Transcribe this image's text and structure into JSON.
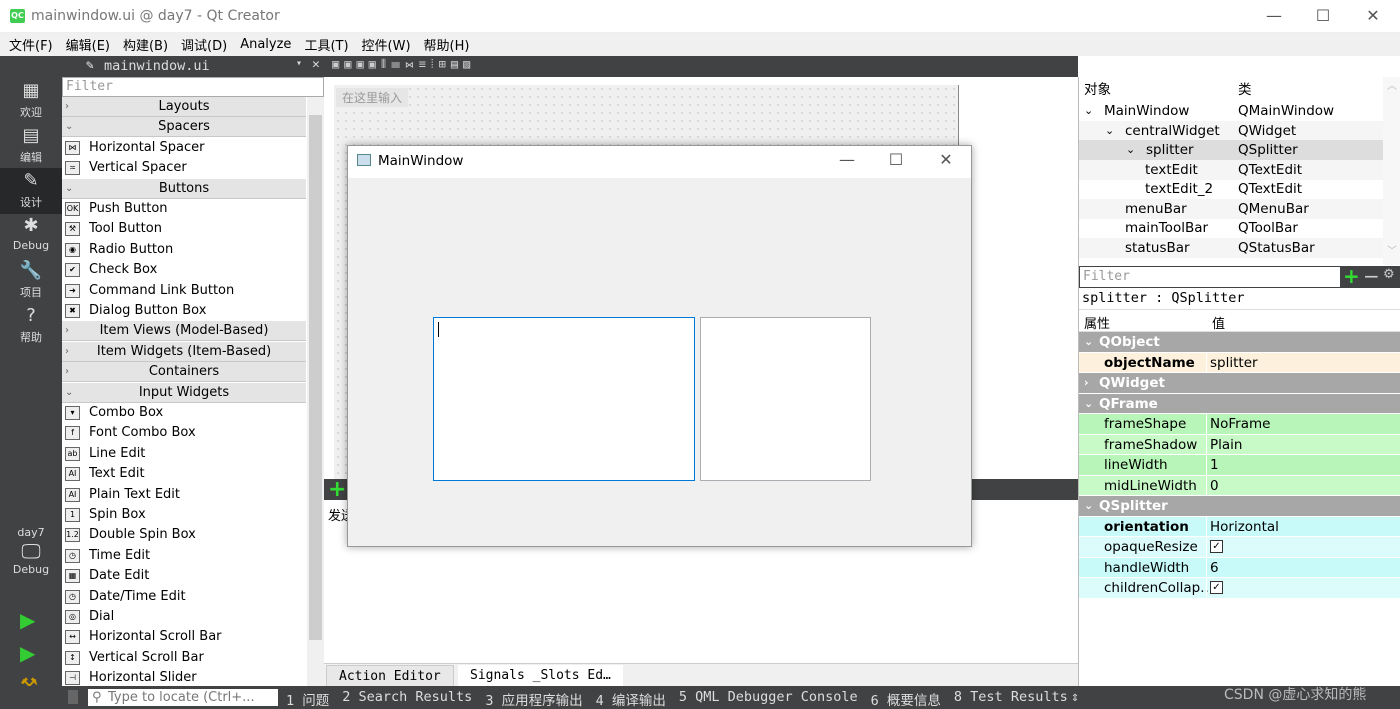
{
  "window": {
    "title": "mainwindow.ui @ day7 - Qt Creator",
    "logo": "QC",
    "minimize": "—",
    "maximize": "☐",
    "close": "✕"
  },
  "menu": [
    "文件(F)",
    "编辑(E)",
    "构建(B)",
    "调试(D)",
    "Analyze",
    "工具(T)",
    "控件(W)",
    "帮助(H)"
  ],
  "modes": [
    {
      "label": "欢迎",
      "icon": "grid-icon"
    },
    {
      "label": "编辑",
      "icon": "edit-icon"
    },
    {
      "label": "设计",
      "icon": "pencil-icon"
    },
    {
      "label": "Debug",
      "icon": "bug-icon"
    },
    {
      "label": "项目",
      "icon": "wrench-icon"
    },
    {
      "label": "帮助",
      "icon": "help-icon"
    }
  ],
  "kit": {
    "project": "day7",
    "mode": "Debug"
  },
  "editor": {
    "filename": "mainwindow.ui"
  },
  "widgetbox": {
    "filter_placeholder": "Filter",
    "rows": [
      {
        "t": "cat",
        "label": "Layouts",
        "open": false
      },
      {
        "t": "cat",
        "label": "Spacers",
        "open": true
      },
      {
        "t": "item",
        "label": "Horizontal Spacer",
        "icon": "⋈"
      },
      {
        "t": "item",
        "label": "Vertical Spacer",
        "icon": "≍"
      },
      {
        "t": "cat",
        "label": "Buttons",
        "open": true
      },
      {
        "t": "item",
        "label": "Push Button",
        "icon": "OK"
      },
      {
        "t": "item",
        "label": "Tool Button",
        "icon": "⚒"
      },
      {
        "t": "item",
        "label": "Radio Button",
        "icon": "◉"
      },
      {
        "t": "item",
        "label": "Check Box",
        "icon": "✔"
      },
      {
        "t": "item",
        "label": "Command Link Button",
        "icon": "➜"
      },
      {
        "t": "item",
        "label": "Dialog Button Box",
        "icon": "✖"
      },
      {
        "t": "cat",
        "label": "Item Views (Model-Based)",
        "open": false
      },
      {
        "t": "cat",
        "label": "Item Widgets (Item-Based)",
        "open": false
      },
      {
        "t": "cat",
        "label": "Containers",
        "open": false
      },
      {
        "t": "cat",
        "label": "Input Widgets",
        "open": true
      },
      {
        "t": "item",
        "label": "Combo Box",
        "icon": "▾"
      },
      {
        "t": "item",
        "label": "Font Combo Box",
        "icon": "f"
      },
      {
        "t": "item",
        "label": "Line Edit",
        "icon": "ab"
      },
      {
        "t": "item",
        "label": "Text Edit",
        "icon": "AI"
      },
      {
        "t": "item",
        "label": "Plain Text Edit",
        "icon": "AI"
      },
      {
        "t": "item",
        "label": "Spin Box",
        "icon": "1"
      },
      {
        "t": "item",
        "label": "Double Spin Box",
        "icon": "1.2"
      },
      {
        "t": "item",
        "label": "Time Edit",
        "icon": "◷"
      },
      {
        "t": "item",
        "label": "Date Edit",
        "icon": "▦"
      },
      {
        "t": "item",
        "label": "Date/Time Edit",
        "icon": "◷"
      },
      {
        "t": "item",
        "label": "Dial",
        "icon": "◎"
      },
      {
        "t": "item",
        "label": "Horizontal Scroll Bar",
        "icon": "↔"
      },
      {
        "t": "item",
        "label": "Vertical Scroll Bar",
        "icon": "↕"
      },
      {
        "t": "item",
        "label": "Horizontal Slider",
        "icon": "⊣"
      }
    ]
  },
  "form": {
    "menu_placeholder": "在这里输入",
    "preview_title": "MainWindow",
    "action_text": "发送"
  },
  "bottom_tabs": [
    "Action Editor",
    "Signals _Slots Ed…"
  ],
  "object_inspector": {
    "headers": [
      "对象",
      "类"
    ],
    "rows": [
      {
        "name": "MainWindow",
        "cls": "QMainWindow",
        "depth": 0,
        "exp": true
      },
      {
        "name": "centralWidget",
        "cls": "QWidget",
        "depth": 1,
        "exp": true
      },
      {
        "name": "splitter",
        "cls": "QSplitter",
        "depth": 2,
        "exp": true,
        "selected": true
      },
      {
        "name": "textEdit",
        "cls": "QTextEdit",
        "depth": 3
      },
      {
        "name": "textEdit_2",
        "cls": "QTextEdit",
        "depth": 3
      },
      {
        "name": "menuBar",
        "cls": "QMenuBar",
        "depth": 1
      },
      {
        "name": "mainToolBar",
        "cls": "QToolBar",
        "depth": 1
      },
      {
        "name": "statusBar",
        "cls": "QStatusBar",
        "depth": 1
      }
    ]
  },
  "property_editor": {
    "filter_placeholder": "Filter",
    "object_label": "splitter : QSplitter",
    "headers": [
      "属性",
      "值"
    ],
    "rows": [
      {
        "t": "grp",
        "name": "QObject",
        "open": true
      },
      {
        "name": "objectName",
        "value": "splitter",
        "bold": true,
        "bg": "#fdf0dc"
      },
      {
        "t": "grp",
        "name": "QWidget",
        "open": false
      },
      {
        "t": "grp",
        "name": "QFrame",
        "open": true
      },
      {
        "name": "frameShape",
        "value": "NoFrame",
        "bg": "#b8f5b8"
      },
      {
        "name": "frameShadow",
        "value": "Plain",
        "bg": "#c8fac8"
      },
      {
        "name": "lineWidth",
        "value": "1",
        "bg": "#b8f5b8"
      },
      {
        "name": "midLineWidth",
        "value": "0",
        "bg": "#c8fac8"
      },
      {
        "t": "grp",
        "name": "QSplitter",
        "open": true
      },
      {
        "name": "orientation",
        "value": "Horizontal",
        "bold": true,
        "bg": "#c8fafa"
      },
      {
        "name": "opaqueResize",
        "value": "",
        "check": true,
        "bg": "#dcfcfc"
      },
      {
        "name": "handleWidth",
        "value": "6",
        "bg": "#c8fafa"
      },
      {
        "name": "childrenCollap...",
        "value": "",
        "check": true,
        "bg": "#dcfcfc"
      }
    ]
  },
  "statusbar": {
    "locator_placeholder": "Type to locate (Ctrl+...",
    "panes": [
      "1 问题",
      "2 Search Results",
      "3 应用程序输出",
      "4 编译输出",
      "5 QML Debugger Console",
      "6 概要信息",
      "8 Test Results"
    ],
    "watermark": "CSDN @虚心求知的熊"
  }
}
